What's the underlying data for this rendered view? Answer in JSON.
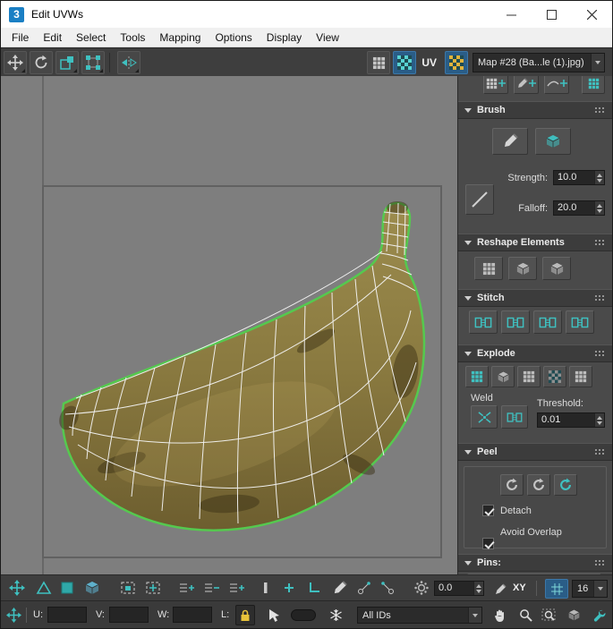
{
  "window": {
    "title": "Edit UVWs",
    "app_icon_glyph": "3"
  },
  "menu": {
    "items": [
      "File",
      "Edit",
      "Select",
      "Tools",
      "Mapping",
      "Options",
      "Display",
      "View"
    ]
  },
  "toolbar": {
    "uv_label": "UV",
    "map_value": "Map #28 (Ba...le (1).jpg)"
  },
  "panel": {
    "brush": {
      "title": "Brush",
      "strength_label": "Strength:",
      "strength_value": "10.0",
      "falloff_label": "Falloff:",
      "falloff_value": "20.0"
    },
    "reshape": {
      "title": "Reshape Elements"
    },
    "stitch": {
      "title": "Stitch"
    },
    "explode": {
      "title": "Explode",
      "weld_label": "Weld",
      "threshold_label": "Threshold:",
      "threshold_value": "0.01"
    },
    "peel": {
      "title": "Peel",
      "detach_label": "Detach",
      "avoid_overlap_label": "Avoid Overlap"
    },
    "pins": {
      "title": "Pins:"
    }
  },
  "bottom_toolbar": {
    "spinner_value": "0.0",
    "axis_label": "XY",
    "grid_value": "16"
  },
  "status_bar": {
    "u_label": "U:",
    "v_label": "V:",
    "w_label": "W:",
    "l_label": "L:",
    "ids_value": "All IDs"
  },
  "colors": {
    "accent_teal": "#3fc0c0",
    "wireframe_green": "#55c94f",
    "selection_blue": "#2a5d87",
    "lock_yellow": "#e8c33a"
  }
}
